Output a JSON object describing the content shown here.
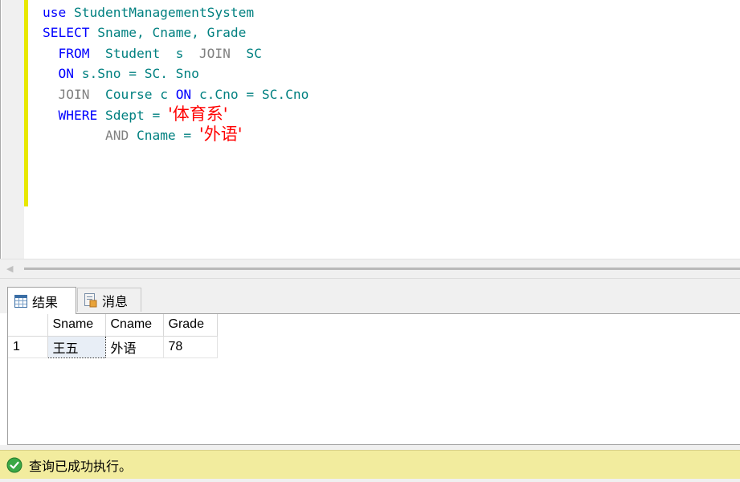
{
  "editor": {
    "lines": [
      [
        {
          "t": "use ",
          "c": "kw"
        },
        {
          "t": "StudentManagementSystem",
          "c": "id"
        }
      ],
      [
        {
          "t": "SELECT ",
          "c": "kw"
        },
        {
          "t": "Sname, Cname, Grade",
          "c": "id"
        }
      ],
      [
        {
          "t": "  FROM  ",
          "c": "kw"
        },
        {
          "t": "Student  s  ",
          "c": "id"
        },
        {
          "t": "JOIN  ",
          "c": "gr"
        },
        {
          "t": "SC",
          "c": "id"
        }
      ],
      [
        {
          "t": "  ON ",
          "c": "kw"
        },
        {
          "t": "s.Sno = SC. Sno",
          "c": "id"
        }
      ],
      [
        {
          "t": "  JOIN  ",
          "c": "gr"
        },
        {
          "t": "Course c ",
          "c": "id"
        },
        {
          "t": "ON ",
          "c": "kw"
        },
        {
          "t": "c.Cno = SC.Cno",
          "c": "id"
        }
      ],
      [
        {
          "t": "  WHERE ",
          "c": "kw"
        },
        {
          "t": "Sdept = ",
          "c": "id"
        },
        {
          "t": "'体育系'",
          "c": "str"
        }
      ],
      [
        {
          "t": "        AND ",
          "c": "gr"
        },
        {
          "t": "Cname = ",
          "c": "id"
        },
        {
          "t": "'外语'",
          "c": "str"
        }
      ]
    ]
  },
  "tabs": {
    "results": "结果",
    "messages": "消息"
  },
  "grid": {
    "columns": [
      "Sname",
      "Cname",
      "Grade"
    ],
    "rows": [
      {
        "num": "1",
        "cells": [
          "王五",
          "外语",
          "78"
        ]
      }
    ]
  },
  "status": {
    "message": "查询已成功执行。",
    "color": "#f2ec9e"
  }
}
